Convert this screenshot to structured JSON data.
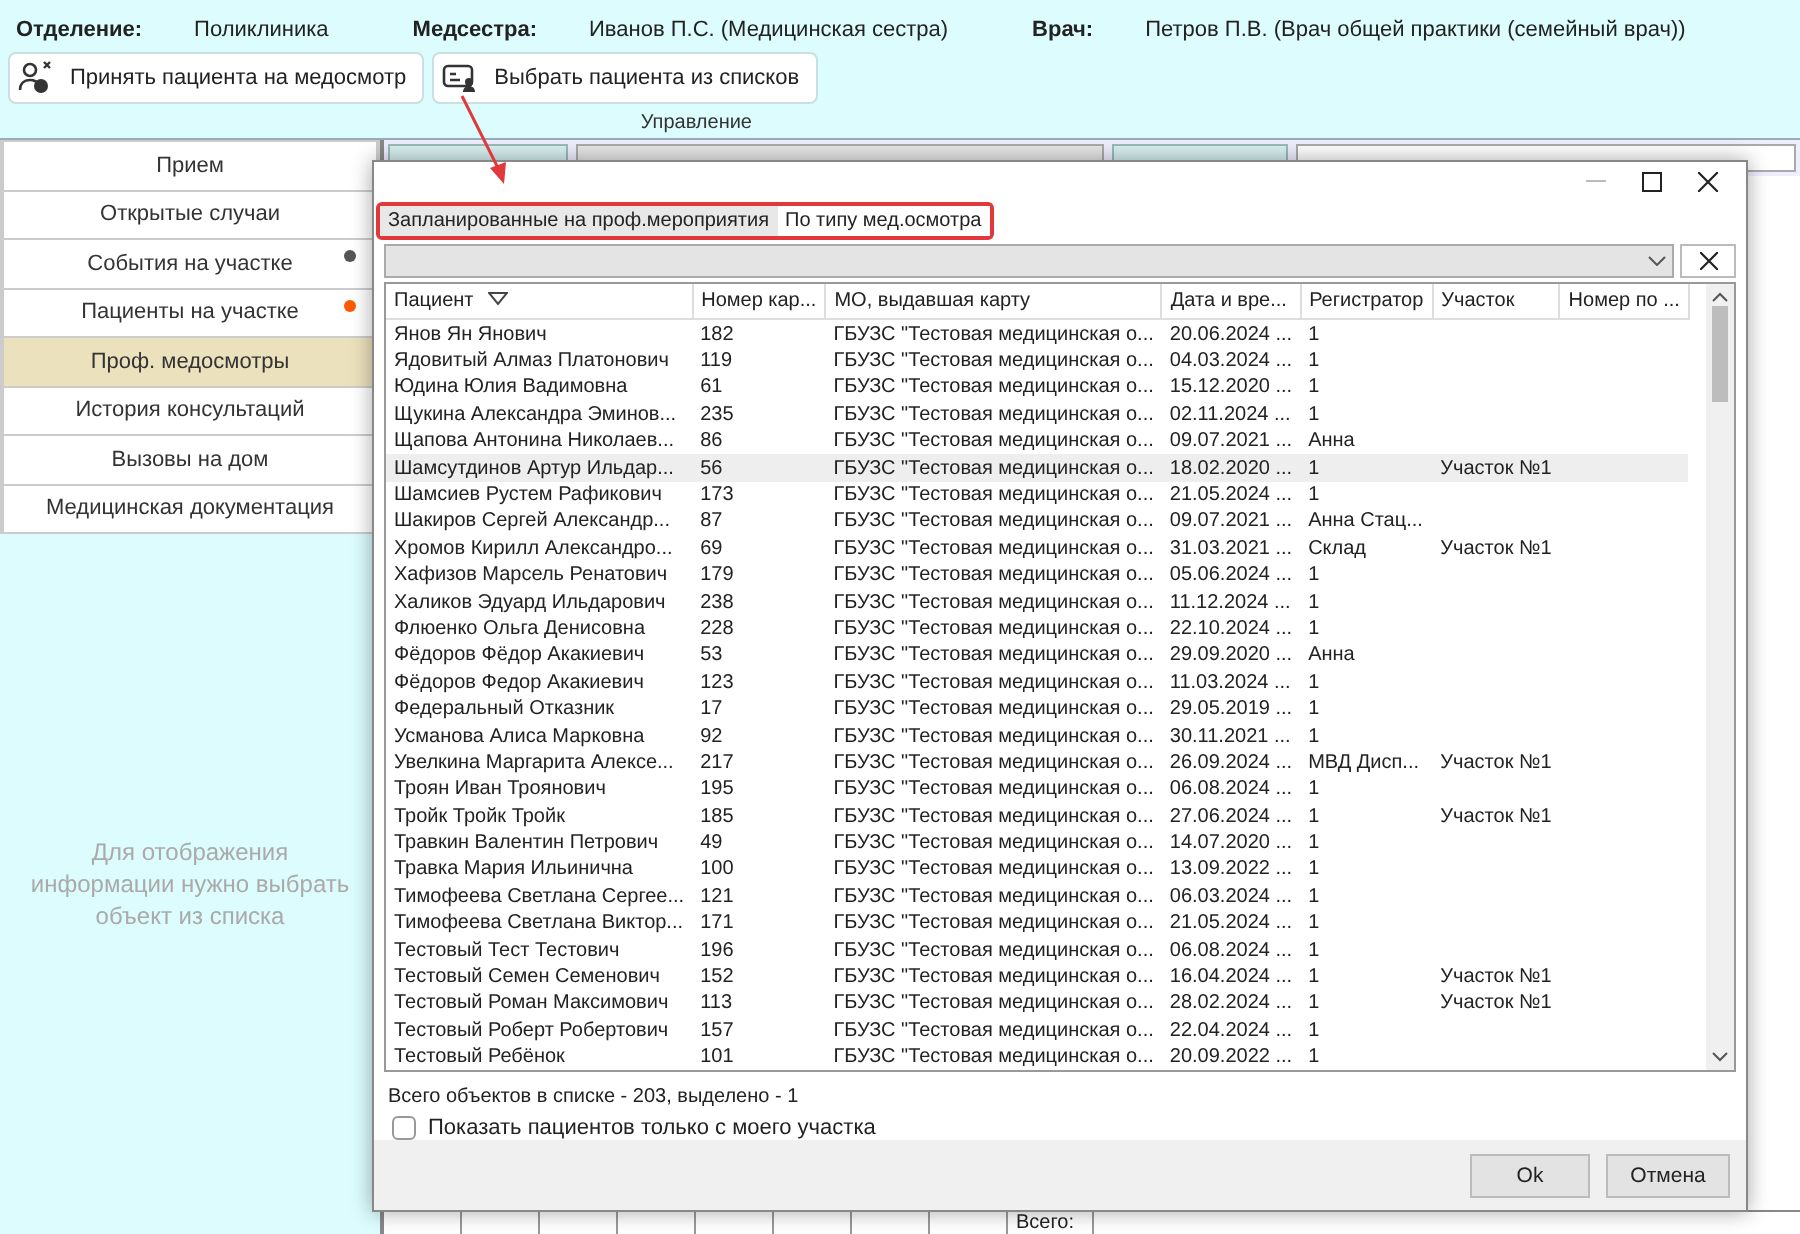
{
  "header": {
    "fields": [
      {
        "label": "Отделение:",
        "value": "Поликлиника"
      },
      {
        "label": "Медсестра:",
        "value": "Иванов П.С. (Медицинская сестра)"
      },
      {
        "label": "Врач:",
        "value": "Петров П.В. (Врач общей практики (семейный врач))"
      }
    ]
  },
  "toolbar": {
    "buttons": [
      {
        "kind": "accept",
        "label": "Принять пациента на медосмотр"
      },
      {
        "kind": "choose",
        "label": "Выбрать пациента из списков"
      }
    ],
    "group_label": "Управление"
  },
  "sidebar": {
    "items": [
      {
        "label": "Прием",
        "selected": false
      },
      {
        "label": "Открытые случаи",
        "selected": false
      },
      {
        "label": "События на участке",
        "selected": false,
        "color": "#555555"
      },
      {
        "label": "Пациенты на участке",
        "selected": false,
        "color": "#ff5a00"
      },
      {
        "label": "Проф. медосмотры",
        "selected": true
      },
      {
        "label": "История консультаций",
        "selected": false
      },
      {
        "label": "Вызовы на дом",
        "selected": false
      },
      {
        "label": "Медицинская документация",
        "selected": false
      }
    ],
    "empty_message": "Для отображения информации нужно выбрать объект из списка"
  },
  "background_grid": {
    "total_label": "Всего:"
  },
  "dialog": {
    "tabs": [
      {
        "label": "Запланированные на проф.мероприятия",
        "selected": false
      },
      {
        "label": "По типу мед.осмотра",
        "selected": true
      }
    ],
    "columns": [
      "Пациент",
      "Номер кар...",
      "МО, выдавшая карту",
      "Дата и вре...",
      "Регистратор",
      "Участок",
      "Номер по ..."
    ],
    "rows": [
      {
        "patient": "Янов Ян Янович",
        "card": "182",
        "org": "ГБУЗС \"Тестовая медицинская о...",
        "date": "20.06.2024 ...",
        "registrar": "1",
        "selected": false
      },
      {
        "patient": "Ядовитый Алмаз Платонович",
        "card": "119",
        "org": "ГБУЗС \"Тестовая медицинская о...",
        "date": "04.03.2024 ...",
        "registrar": "1",
        "selected": false
      },
      {
        "patient": "Юдина Юлия Вадимовна",
        "card": "61",
        "org": "ГБУЗС \"Тестовая медицинская о...",
        "date": "15.12.2020 ...",
        "registrar": "1",
        "selected": false
      },
      {
        "patient": "Щукина Александра Эминов...",
        "card": "235",
        "org": "ГБУЗС \"Тестовая медицинская о...",
        "date": "02.11.2024 ...",
        "registrar": "1",
        "selected": false
      },
      {
        "patient": "Щапова Антонина Николаев...",
        "card": "86",
        "org": "ГБУЗС \"Тестовая медицинская о...",
        "date": "09.07.2021 ...",
        "registrar": "Анна",
        "selected": false
      },
      {
        "patient": "Шамсутдинов Артур Ильдар...",
        "card": "56",
        "org": "ГБУЗС \"Тестовая медицинская о...",
        "date": "18.02.2020 ...",
        "registrar": "1",
        "district": "Участок №1",
        "selected": true
      },
      {
        "patient": "Шамсиев Рустем Рафикович",
        "card": "173",
        "org": "ГБУЗС \"Тестовая медицинская о...",
        "date": "21.05.2024 ...",
        "registrar": "1",
        "selected": false
      },
      {
        "patient": "Шакиров Сергей Александр...",
        "card": "87",
        "org": "ГБУЗС \"Тестовая медицинская о...",
        "date": "09.07.2021 ...",
        "registrar": "Анна Стац...",
        "selected": false
      },
      {
        "patient": "Хромов Кирилл Александро...",
        "card": "69",
        "org": "ГБУЗС \"Тестовая медицинская о...",
        "date": "31.03.2021 ...",
        "registrar": "Склад",
        "district": "Участок №1",
        "selected": false
      },
      {
        "patient": "Хафизов Марсель Ренатович",
        "card": "179",
        "org": "ГБУЗС \"Тестовая медицинская о...",
        "date": "05.06.2024 ...",
        "registrar": "1",
        "selected": false
      },
      {
        "patient": "Халиков Эдуард Ильдарович",
        "card": "238",
        "org": "ГБУЗС \"Тестовая медицинская о...",
        "date": "11.12.2024 ...",
        "registrar": "1",
        "selected": false
      },
      {
        "patient": "Флюенко Ольга Денисовна",
        "card": "228",
        "org": "ГБУЗС \"Тестовая медицинская о...",
        "date": "22.10.2024 ...",
        "registrar": "1",
        "selected": false
      },
      {
        "patient": "Фёдоров Фёдор Акакиевич",
        "card": "53",
        "org": "ГБУЗС \"Тестовая медицинская о...",
        "date": "29.09.2020 ...",
        "registrar": "Анна",
        "selected": false
      },
      {
        "patient": "Фёдоров Федор Акакиевич",
        "card": "123",
        "org": "ГБУЗС \"Тестовая медицинская о...",
        "date": "11.03.2024 ...",
        "registrar": "1",
        "selected": false
      },
      {
        "patient": "Федеральный Отказник",
        "card": "17",
        "org": "ГБУЗС \"Тестовая медицинская о...",
        "date": "29.05.2019 ...",
        "registrar": "1",
        "selected": false
      },
      {
        "patient": "Усманова Алиса Марковна",
        "card": "92",
        "org": "ГБУЗС \"Тестовая медицинская о...",
        "date": "30.11.2021 ...",
        "registrar": "1",
        "selected": false
      },
      {
        "patient": "Увелкина Маргарита Алексе...",
        "card": "217",
        "org": "ГБУЗС \"Тестовая медицинская о...",
        "date": "26.09.2024 ...",
        "registrar": "МВД Дисп...",
        "district": "Участок №1",
        "selected": false
      },
      {
        "patient": "Троян Иван Троянович",
        "card": "195",
        "org": "ГБУЗС \"Тестовая медицинская о...",
        "date": "06.08.2024 ...",
        "registrar": "1",
        "selected": false
      },
      {
        "patient": "Тройк Тройк Тройк",
        "card": "185",
        "org": "ГБУЗС \"Тестовая медицинская о...",
        "date": "27.06.2024 ...",
        "registrar": "1",
        "district": "Участок №1",
        "selected": false
      },
      {
        "patient": "Травкин Валентин Петрович",
        "card": "49",
        "org": "ГБУЗС \"Тестовая медицинская о...",
        "date": "14.07.2020 ...",
        "registrar": "1",
        "selected": false
      },
      {
        "patient": "Травка Мария Ильинична",
        "card": "100",
        "org": "ГБУЗС \"Тестовая медицинская о...",
        "date": "13.09.2022 ...",
        "registrar": "1",
        "selected": false
      },
      {
        "patient": "Тимофеева Светлана Сергее...",
        "card": "121",
        "org": "ГБУЗС \"Тестовая медицинская о...",
        "date": "06.03.2024 ...",
        "registrar": "1",
        "selected": false
      },
      {
        "patient": "Тимофеева Светлана Виктор...",
        "card": "171",
        "org": "ГБУЗС \"Тестовая медицинская о...",
        "date": "21.05.2024 ...",
        "registrar": "1",
        "selected": false
      },
      {
        "patient": "Тестовый Тест Тестович",
        "card": "196",
        "org": "ГБУЗС \"Тестовая медицинская о...",
        "date": "06.08.2024 ...",
        "registrar": "1",
        "selected": false
      },
      {
        "patient": "Тестовый Семен Семенович",
        "card": "152",
        "org": "ГБУЗС \"Тестовая медицинская о...",
        "date": "16.04.2024 ...",
        "registrar": "1",
        "district": "Участок №1",
        "selected": false
      },
      {
        "patient": "Тестовый Роман Максимович",
        "card": "113",
        "org": "ГБУЗС \"Тестовая медицинская о...",
        "date": "28.02.2024 ...",
        "registrar": "1",
        "district": "Участок №1",
        "selected": false
      },
      {
        "patient": "Тестовый Роберт Робертович",
        "card": "157",
        "org": "ГБУЗС \"Тестовая медицинская о...",
        "date": "22.04.2024 ...",
        "registrar": "1",
        "selected": false
      },
      {
        "patient": "Тестовый Ребёнок",
        "card": "101",
        "org": "ГБУЗС \"Тестовая медицинская о...",
        "date": "20.09.2022 ...",
        "registrar": "1",
        "selected": false
      }
    ],
    "summary": "Всего объектов в списке - 203, выделено - 1",
    "checkbox": {
      "label": "Показать пациентов только с моего участка",
      "checked": false
    },
    "buttons": [
      "Ok",
      "Отмена"
    ]
  }
}
